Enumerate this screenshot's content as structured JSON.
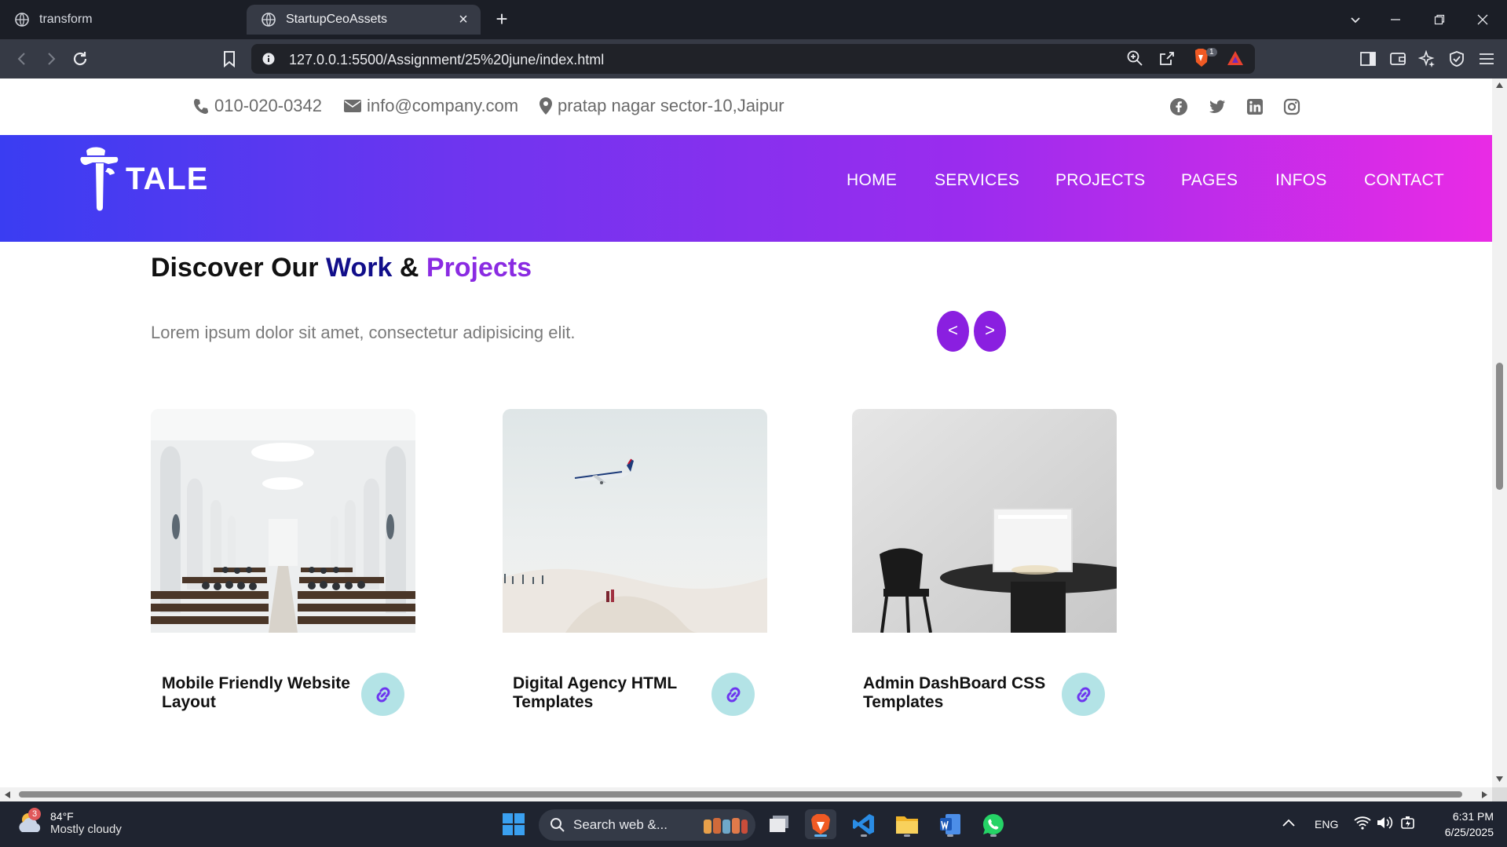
{
  "browser": {
    "tabs": [
      {
        "title": "transform",
        "active": false
      },
      {
        "title": "StartupCeoAssets",
        "active": true
      }
    ],
    "url": "127.0.0.1:5500/Assignment/25%20june/index.html",
    "shields_badge": "1"
  },
  "site": {
    "topbar": {
      "phone": "010-020-0342",
      "email": "info@company.com",
      "address": "pratap nagar sector-10,Jaipur",
      "social_icons": [
        "facebook-icon",
        "twitter-icon",
        "linkedin-icon",
        "instagram-icon"
      ]
    },
    "logo_text": "TALE",
    "nav": [
      "HOME",
      "SERVICES",
      "PROJECTS",
      "PAGES",
      "INFOS",
      "CONTACT"
    ],
    "section": {
      "title_prefix": "Discover Our ",
      "title_work": "Work",
      "title_amp": " & ",
      "title_projects": "Projects",
      "description": "Lorem ipsum dolor sit amet, consectetur adipisicing elit.",
      "prev_label": "<",
      "next_label": ">"
    },
    "projects": [
      {
        "title": "Mobile Friendly Website Layout",
        "image": "church-interior"
      },
      {
        "title": "Digital Agency HTML Templates",
        "image": "airplane-sky"
      },
      {
        "title": "Admin DashBoard CSS Templates",
        "image": "table-chair"
      }
    ],
    "colors": {
      "title_work": "#110e8a",
      "title_projects": "#8a2be2",
      "arrow_button": "#8a1fe0",
      "link_button": "#b3e3e6",
      "nav_gradient_start": "#3a3df2",
      "nav_gradient_end": "#e92be5"
    }
  },
  "taskbar": {
    "weather_temp": "84°F",
    "weather_desc": "Mostly cloudy",
    "weather_badge": "3",
    "search_placeholder": "Search web &...",
    "language": "ENG",
    "time": "6:31 PM",
    "date": "6/25/2025"
  }
}
